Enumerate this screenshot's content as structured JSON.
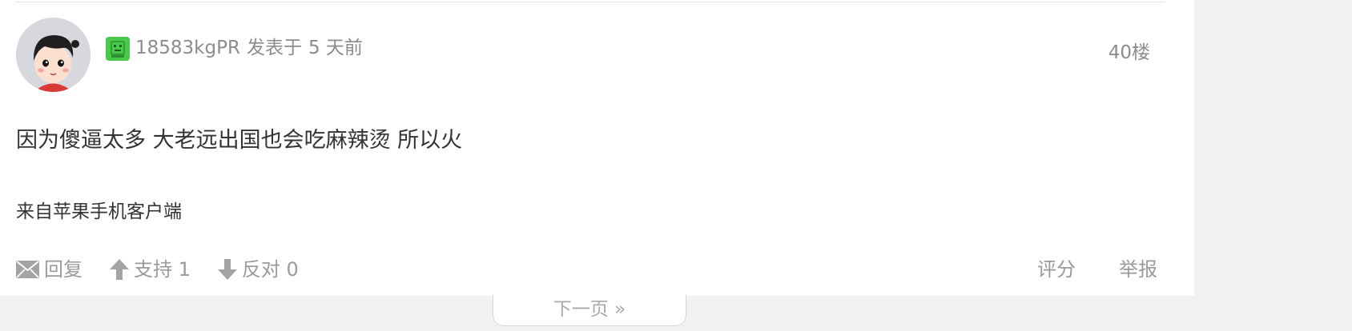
{
  "post": {
    "username": "18583kgPR",
    "posted_label": "发表于",
    "time": "5 天前",
    "floor": "40楼",
    "content": "因为傻逼太多 大老远出国也会吃麻辣烫 所以火",
    "source": "来自苹果手机客户端"
  },
  "actions": {
    "reply": "回复",
    "support": "支持 1",
    "oppose": "反对 0",
    "rate": "评分",
    "report": "举报"
  },
  "pagination": {
    "next": "下一页 »"
  },
  "colors": {
    "badge": "#49c94a",
    "muted_text": "#8c8c8c",
    "body_text": "#333333",
    "page_bg": "#f2f1ef"
  },
  "icons": {
    "avatar": "cartoon-avatar",
    "level": "level-badge-icon",
    "reply": "envelope-icon",
    "support": "arrow-up-icon",
    "oppose": "arrow-down-icon"
  }
}
